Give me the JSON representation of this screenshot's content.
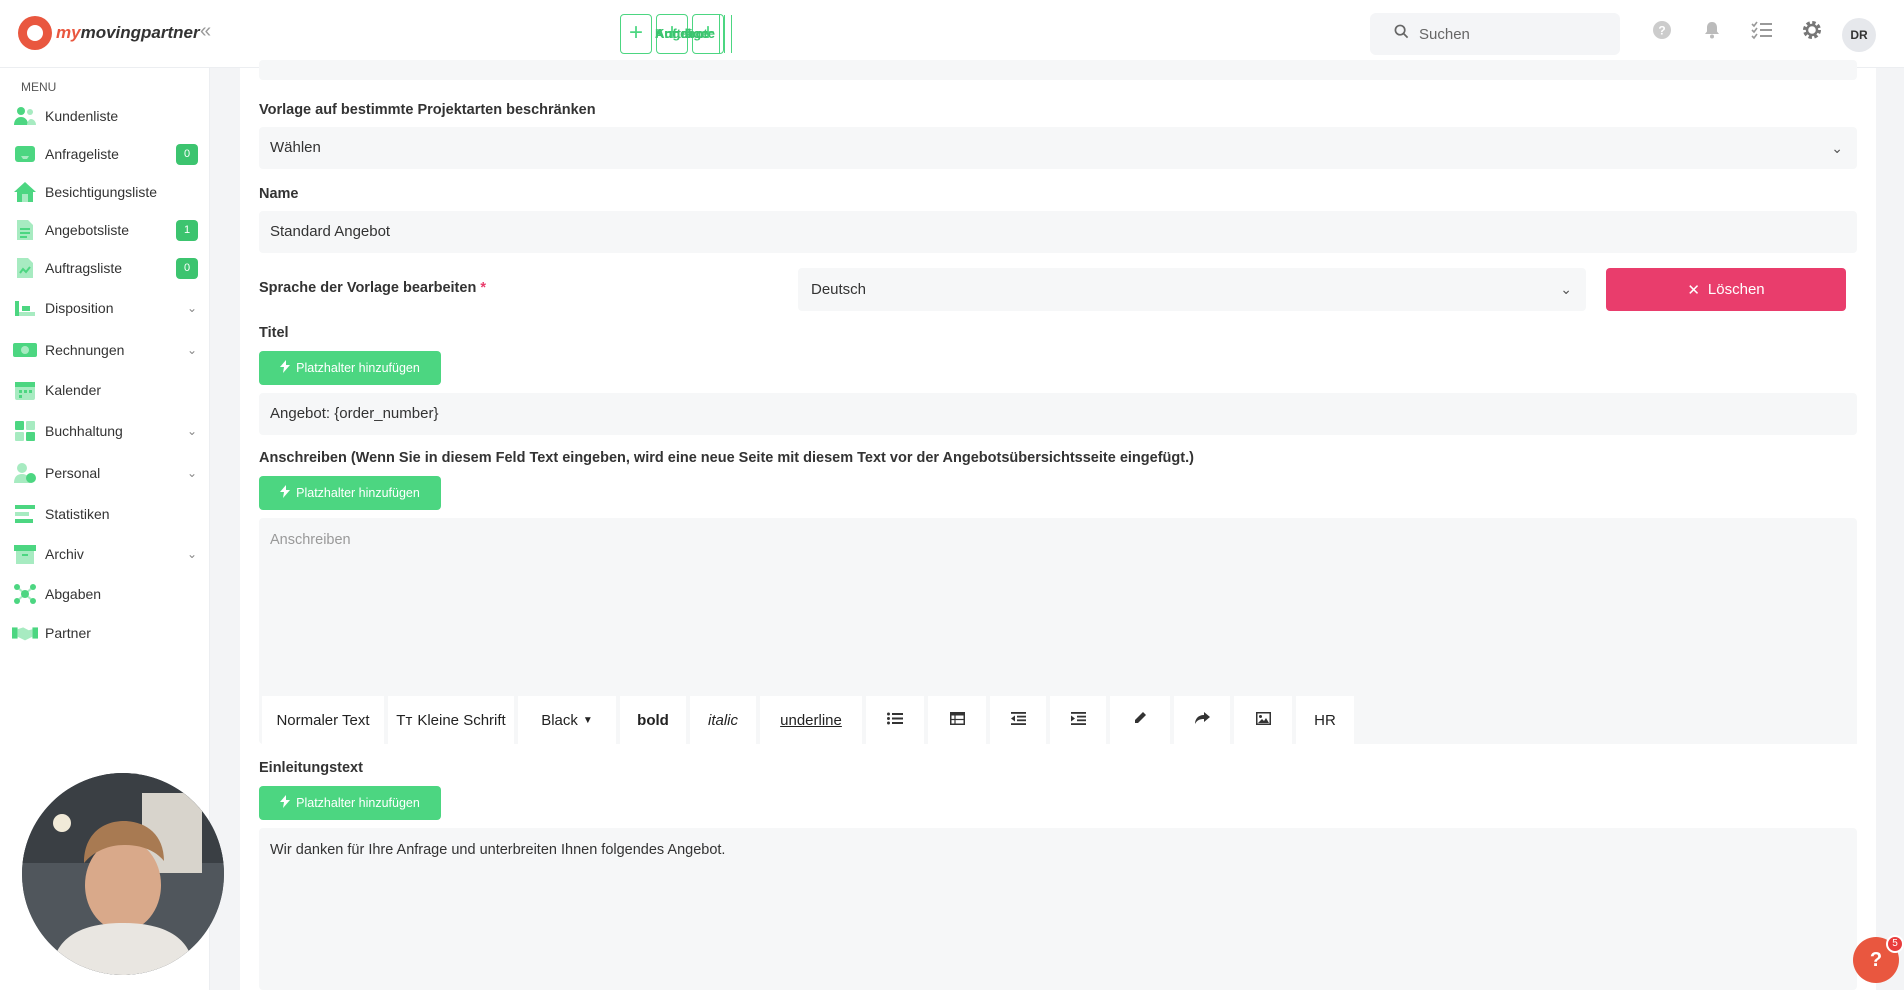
{
  "brand": {
    "logo_text_1": "my",
    "logo_text_2": "movingpartner"
  },
  "topnav": [
    {
      "label": "Kunden"
    },
    {
      "label": "Angebote"
    },
    {
      "label": "Aufträge"
    }
  ],
  "plus_glyph": "+",
  "search": {
    "placeholder": "Suchen"
  },
  "user": {
    "initials": "DR"
  },
  "sidebar": {
    "menu_label": "MENU",
    "items": [
      {
        "label": "Kundenliste",
        "icon": "users-icon"
      },
      {
        "label": "Anfrageliste",
        "icon": "inbox-icon",
        "badge": "0"
      },
      {
        "label": "Besichtigungsliste",
        "icon": "home-icon"
      },
      {
        "label": "Angebotsliste",
        "icon": "document-icon",
        "badge": "1"
      },
      {
        "label": "Auftragsliste",
        "icon": "contract-icon",
        "badge": "0"
      },
      {
        "label": "Disposition",
        "icon": "truck-icon"
      },
      {
        "label": "Rechnungen",
        "icon": "money-icon"
      },
      {
        "label": "Kalender",
        "icon": "calendar-icon"
      },
      {
        "label": "Buchhaltung",
        "icon": "grid-icon"
      },
      {
        "label": "Personal",
        "icon": "person-icon"
      },
      {
        "label": "Statistiken",
        "icon": "chart-icon"
      },
      {
        "label": "Archiv",
        "icon": "archive-icon"
      },
      {
        "label": "Abgaben",
        "icon": "network-icon"
      },
      {
        "label": "Partner",
        "icon": "handshake-icon"
      }
    ]
  },
  "form": {
    "restrict_label": "Vorlage auf bestimmte Projektarten beschränken",
    "restrict_value": "Wählen",
    "name_label": "Name",
    "name_value": "Standard Angebot",
    "lang_label": "Sprache der Vorlage bearbeiten",
    "lang_required": "*",
    "lang_value": "Deutsch",
    "delete_label": "Löschen",
    "title_label": "Titel",
    "placeholder_btn": "Platzhalter hinzufügen",
    "title_value": "Angebot: {order_number}",
    "cover_label": "Anschreiben (Wenn Sie in diesem Feld Text eingeben, wird eine neue Seite mit diesem Text vor der Angebotsübersichtsseite eingefügt.)",
    "cover_placeholder": "Anschreiben",
    "intro_label": "Einleitungstext",
    "intro_value": "Wir danken für Ihre Anfrage und unterbreiten Ihnen folgendes Angebot."
  },
  "toolbar": {
    "normal_text": "Normaler Text",
    "small_text": "Kleine Schrift",
    "small_prefix": "Tт",
    "color": "Black",
    "bold": "bold",
    "italic": "italic",
    "underline": "underline",
    "hr": "HR"
  },
  "help": {
    "glyph": "?",
    "badge": "5"
  },
  "colors": {
    "accent_green": "#4cd681",
    "danger": "#e93d6c",
    "brand_orange": "#e9573f"
  }
}
